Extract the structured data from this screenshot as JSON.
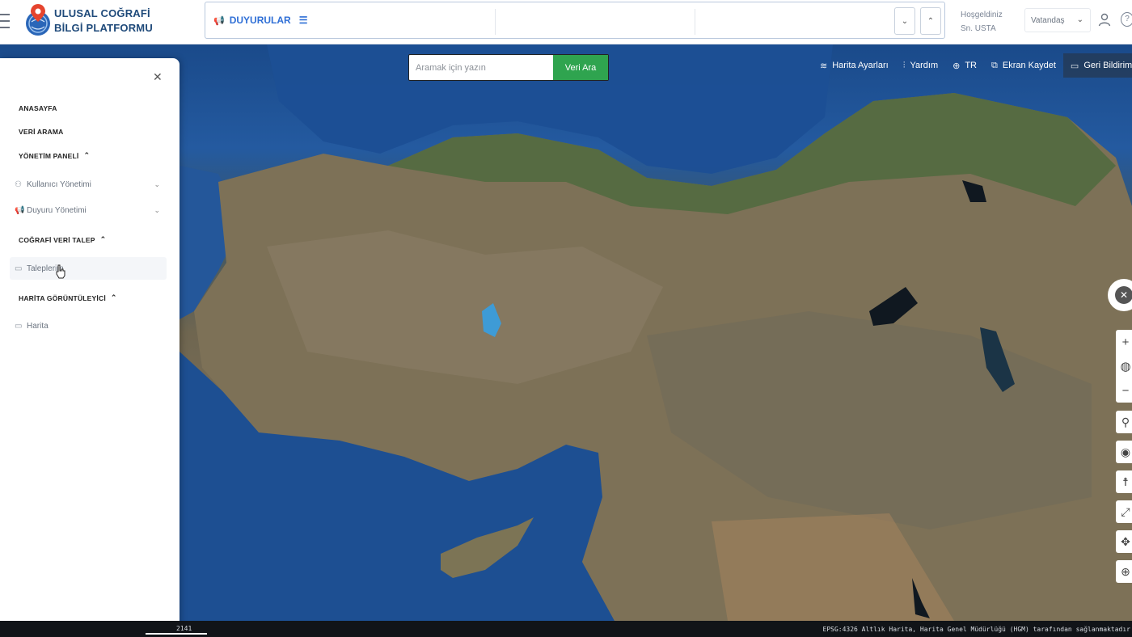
{
  "header": {
    "brand_line1": "ULUSAL COĞRAFİ",
    "brand_line2": "BİLGİ PLATFORMU",
    "announcements_label": "DUYURULAR",
    "welcome_line1": "Hoşgeldiniz",
    "welcome_line2": "Sn. USTA",
    "role_selected": "Vatandaş"
  },
  "search": {
    "placeholder": "Aramak için yazın",
    "button_label": "Veri Ara"
  },
  "toolbar": {
    "map_settings": "Harita Ayarları",
    "help": "Yardım",
    "language": "TR",
    "screen_record": "Ekran Kaydet",
    "feedback": "Geri Bildirim"
  },
  "sidebar": {
    "home": "ANASAYFA",
    "data_search": "VERİ ARAMA",
    "admin_panel": "YÖNETİM PANELİ",
    "user_management": "Kullanıcı Yönetimi",
    "announcement_management": "Duyuru Yönetimi",
    "geo_data_request": "COĞRAFİ VERİ TALEP",
    "requests": "Taleplerim",
    "map_viewer": "HARİTA GÖRÜNTÜLEYİCİ",
    "map": "Harita"
  },
  "footer": {
    "scale": "2141",
    "attribution": "EPSG:4326 Altlık Harita, Harita Genel Müdürlüğü (HGM) tarafından sağlanmaktadır"
  },
  "colors": {
    "accent_blue": "#2f6fd6",
    "search_green": "#2fa44f",
    "brand_navy": "#1f4a7a"
  }
}
